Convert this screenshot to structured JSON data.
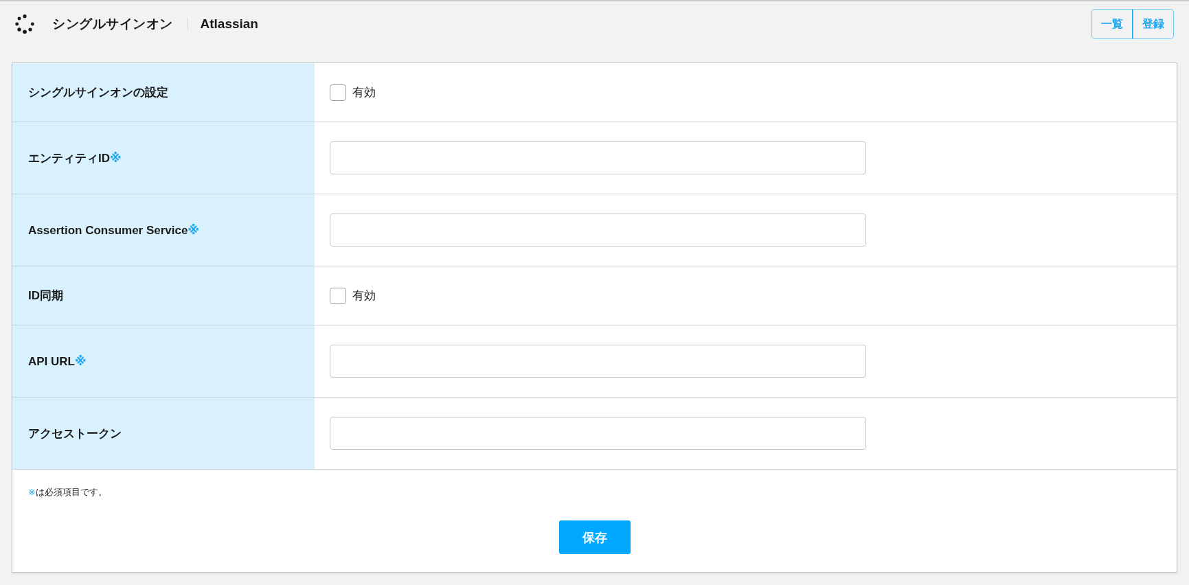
{
  "header": {
    "title": "シングルサインオン",
    "service": "Atlassian",
    "buttons": [
      {
        "label": "一覧"
      },
      {
        "label": "登録"
      }
    ]
  },
  "form": {
    "rows": [
      {
        "kind": "checkbox",
        "label": "シングルサインオンの設定",
        "option": "有効",
        "checked": false
      },
      {
        "kind": "text",
        "label": "エンティティID",
        "required_mark": "※"
      },
      {
        "kind": "text",
        "label": "Assertion Consumer Service",
        "required_mark": "※"
      },
      {
        "kind": "checkbox",
        "label": "ID同期",
        "option": "有効",
        "checked": false
      },
      {
        "kind": "text",
        "label": "API URL",
        "required_mark": "※"
      },
      {
        "kind": "text",
        "label": "アクセストークン"
      }
    ],
    "note_mark": "※",
    "note": "は必須項目です。",
    "save_button": "保存"
  }
}
